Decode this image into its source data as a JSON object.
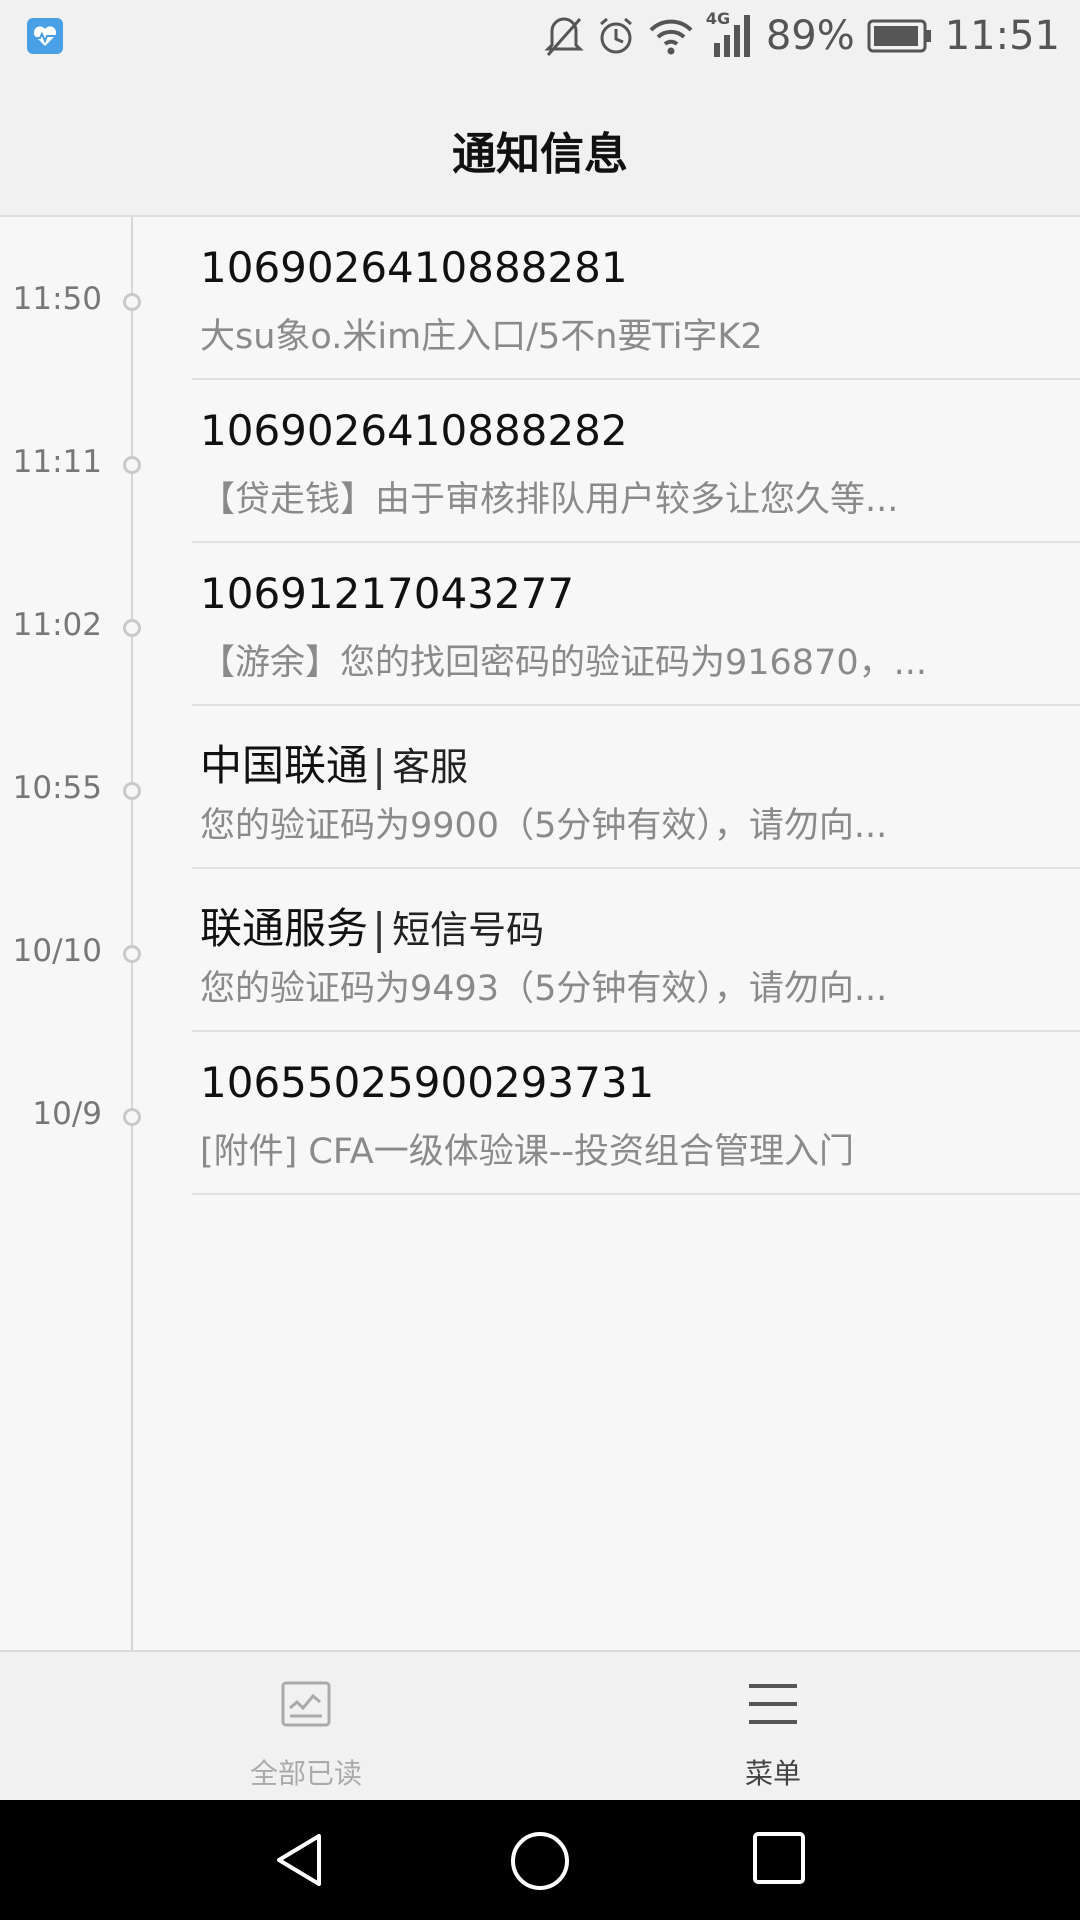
{
  "status_bar": {
    "battery_percent": "89%",
    "time": "11:51",
    "network_type": "4G",
    "icons": [
      "health-app-icon",
      "mute-icon",
      "alarm-icon",
      "wifi-icon",
      "signal-icon",
      "battery-icon"
    ]
  },
  "header": {
    "title": "通知信息"
  },
  "messages": [
    {
      "time": "11:50",
      "sender": "1069026410888281",
      "sender_sub": "",
      "preview": "大su象o.米im庄入口/5不n要Ti字K2"
    },
    {
      "time": "11:11",
      "sender": "1069026410888282",
      "sender_sub": "",
      "preview": "【贷走钱】由于审核排队用户较多让您久等..."
    },
    {
      "time": "11:02",
      "sender": "10691217043277",
      "sender_sub": "",
      "preview": "【游余】您的找回密码的验证码为916870，..."
    },
    {
      "time": "10:55",
      "sender": "中国联通",
      "sender_sub": "客服",
      "preview": "您的验证码为9900（5分钟有效），请勿向..."
    },
    {
      "time": "10/10",
      "sender": "联通服务",
      "sender_sub": "短信号码",
      "preview": "您的验证码为9493（5分钟有效），请勿向..."
    },
    {
      "time": "10/9",
      "sender": "10655025900293731",
      "sender_sub": "",
      "preview": "[附件] CFA一级体验课--投资组合管理入门"
    }
  ],
  "bottom_bar": {
    "mark_all_read_label": "全部已读",
    "menu_label": "菜单"
  },
  "colors": {
    "background": "#f5f5f5",
    "timeline": "#d6d6d6",
    "disabled": "#aaaaaa",
    "nav_bar": "#000000"
  }
}
